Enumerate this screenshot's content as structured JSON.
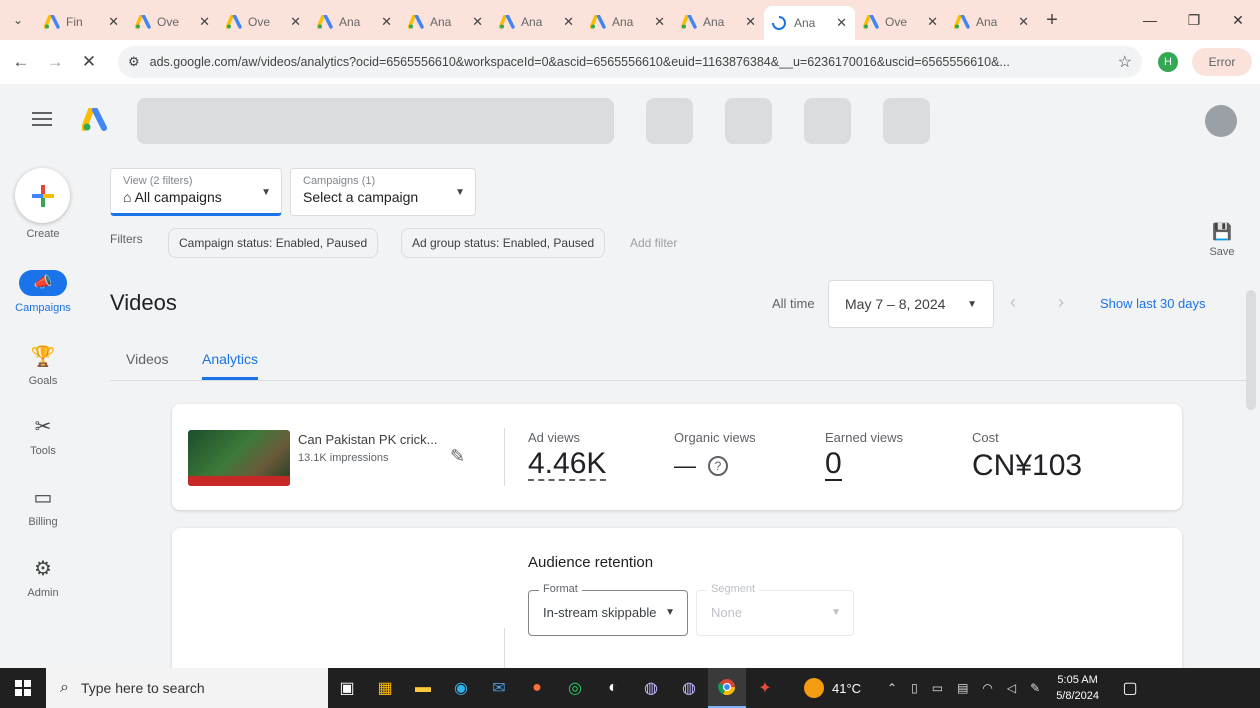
{
  "browser": {
    "tabs": [
      {
        "label": "Fin",
        "active": false
      },
      {
        "label": "Ove",
        "active": false
      },
      {
        "label": "Ove",
        "active": false
      },
      {
        "label": "Ana",
        "active": false
      },
      {
        "label": "Ana",
        "active": false
      },
      {
        "label": "Ana",
        "active": false
      },
      {
        "label": "Ana",
        "active": false
      },
      {
        "label": "Ana",
        "active": false
      },
      {
        "label": "Ana",
        "active": true
      },
      {
        "label": "Ove",
        "active": false
      },
      {
        "label": "Ana",
        "active": false
      }
    ],
    "url": "ads.google.com/aw/videos/analytics?ocid=6565556610&workspaceId=0&ascid=6565556610&euid=1163876384&__u=6236170016&uscid=6565556610&...",
    "profile_initial": "H",
    "error_label": "Error"
  },
  "sidebar": {
    "create": "Create",
    "items": [
      {
        "label": "Campaigns",
        "icon": "megaphone-icon"
      },
      {
        "label": "Goals",
        "icon": "trophy-icon"
      },
      {
        "label": "Tools",
        "icon": "tools-icon"
      },
      {
        "label": "Billing",
        "icon": "card-icon"
      },
      {
        "label": "Admin",
        "icon": "gear-icon"
      }
    ]
  },
  "filters": {
    "view_small": "View (2 filters)",
    "view_value": "All campaigns",
    "campaigns_small": "Campaigns (1)",
    "campaigns_value": "Select a campaign",
    "filters_label": "Filters",
    "chip1": "Campaign status: Enabled, Paused",
    "chip2": "Ad group status: Enabled, Paused",
    "add_filter": "Add filter",
    "save": "Save"
  },
  "page": {
    "title": "Videos",
    "all_time": "All time",
    "date_range": "May 7 – 8, 2024",
    "show_last": "Show last 30 days",
    "tabs": [
      "Videos",
      "Analytics"
    ]
  },
  "video": {
    "title": "Can Pakistan PK crick...",
    "impressions": "13.1K impressions",
    "ad_views_label": "Ad views",
    "ad_views": "4.46K",
    "organic_label": "Organic views",
    "organic": "—",
    "earned_label": "Earned views",
    "earned": "0",
    "cost_label": "Cost",
    "cost": "CN¥103"
  },
  "retention": {
    "title": "Audience retention",
    "format_label": "Format",
    "format_value": "In-stream skippable",
    "segment_label": "Segment",
    "segment_value": "None"
  },
  "taskbar": {
    "search": "Type here to search",
    "weather": "41°C",
    "time": "5:05 AM",
    "date": "5/8/2024"
  }
}
